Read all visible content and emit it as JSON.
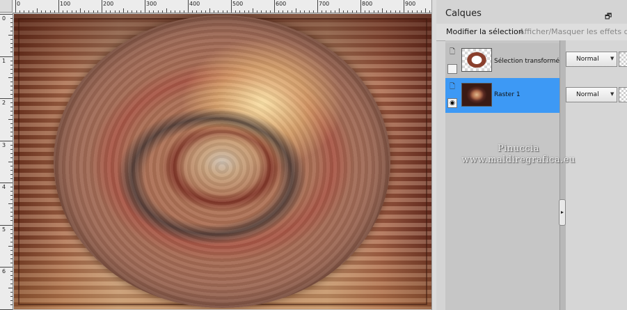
{
  "panel": {
    "title": "Calques",
    "float_icon": "restore-window-icon",
    "toolbar": {
      "modify_selection": "Modifier la sélection",
      "toggle_effects": "Afficher/Masquer les effets de c"
    }
  },
  "layers": [
    {
      "name": "Sélection transformée",
      "blend_mode": "Normal",
      "selected": false,
      "visible": false
    },
    {
      "name": "Raster 1",
      "blend_mode": "Normal",
      "selected": true,
      "visible": true
    }
  ],
  "ruler": {
    "top_labels": [
      "0",
      "100",
      "200",
      "300",
      "400",
      "500",
      "600",
      "700",
      "800",
      "900"
    ],
    "left_labels": [
      "0",
      "1",
      "2",
      "3",
      "4",
      "5",
      "6"
    ]
  },
  "watermark": {
    "line1": "Pinuccia",
    "line2": "www.maldiregrafica.eu"
  },
  "colors": {
    "selection_blue": "#3d99f5",
    "panel_gray": "#d4d4d4"
  }
}
